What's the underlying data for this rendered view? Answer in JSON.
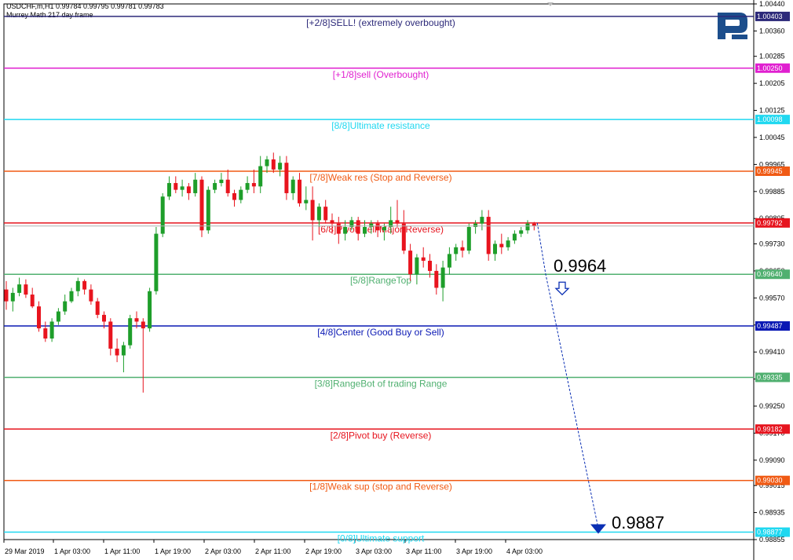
{
  "header": {
    "symbol_line": "USDCHF,m,H1  0.99784 0.99795 0.99781 0.99783",
    "indicator": "Murrey Math 217 day frame"
  },
  "colors": {
    "bull": "#1e9e2a",
    "bear": "#e8141e",
    "arrow": "#0a2fb4",
    "logo": "#1c4e8c"
  },
  "annotations": {
    "target_upper": "0.9964",
    "target_lower": "0.9887"
  },
  "chart_data": {
    "type": "candlestick",
    "title": "USDCHF,m,H1",
    "ylim": [
      0.98855,
      1.0044
    ],
    "y_ticks": [
      "1.00440",
      "1.00360",
      "1.00285",
      "1.00205",
      "1.00125",
      "1.00045",
      "0.99965",
      "0.99885",
      "0.99805",
      "0.99730",
      "0.99650",
      "0.99570",
      "0.99490",
      "0.99410",
      "0.99330",
      "0.99250",
      "0.99170",
      "0.99090",
      "0.99015",
      "0.98935",
      "0.98855"
    ],
    "x_ticks": [
      "29 Mar 2019",
      "1 Apr 03:00",
      "1 Apr 11:00",
      "1 Apr 19:00",
      "2 Apr 03:00",
      "2 Apr 11:00",
      "2 Apr 19:00",
      "3 Apr 03:00",
      "3 Apr 11:00",
      "3 Apr 19:00",
      "4 Apr 03:00"
    ],
    "levels": [
      {
        "label": "[+2/8]SELL! (extremely overbought)",
        "value": 1.00403,
        "value_text": "1.00403",
        "color": "#2d2a7a"
      },
      {
        "label": "[+1/8]sell (Overbought)",
        "value": 1.0025,
        "value_text": "1.00250",
        "color": "#e020d0"
      },
      {
        "label": "[8/8]Ultimate resistance",
        "value": 1.00098,
        "value_text": "1.00098",
        "color": "#20d8f0"
      },
      {
        "label": "[7/8]Weak res (Stop and Reverse)",
        "value": 0.99945,
        "value_text": "0.99945",
        "color": "#f05a14"
      },
      {
        "label": "[6/8]Pivot, sell Major Reverse)",
        "value": 0.99792,
        "value_text": "0.99792",
        "color": "#e6141e"
      },
      {
        "label": "[5/8]RangeTop",
        "value": 0.9964,
        "value_text": "0.99640",
        "color": "#50b070"
      },
      {
        "label": "[4/8]Center (Good Buy or Sell)",
        "value": 0.99487,
        "value_text": "0.99487",
        "color": "#0a18b4"
      },
      {
        "label": "[3/8]RangeBot of trading Range",
        "value": 0.99335,
        "value_text": "0.99335",
        "color": "#50b070"
      },
      {
        "label": "[2/8]Pivot buy (Reverse)",
        "value": 0.99182,
        "value_text": "0.99182",
        "color": "#e6141e"
      },
      {
        "label": "[1/8]Weak sup (stop and Reverse)",
        "value": 0.9903,
        "value_text": "0.99030",
        "color": "#f05a14"
      },
      {
        "label": "[0/8]Ultimate support",
        "value": 0.98877,
        "value_text": "0.98877",
        "color": "#20d8f0"
      }
    ],
    "current_price": 0.99783,
    "current_price_text": "0.99783",
    "forecast": [
      {
        "x": "4 Apr 08:00",
        "y": 0.99792
      },
      {
        "x": "4 Apr 09:00",
        "y": 0.9964
      },
      {
        "x": "4 Apr 14:00",
        "y": 0.98877
      }
    ],
    "candles": [
      [
        0.99595,
        0.9962,
        0.99535,
        0.9956
      ],
      [
        0.9956,
        0.996,
        0.9953,
        0.99585
      ],
      [
        0.99585,
        0.9963,
        0.99575,
        0.9961
      ],
      [
        0.9961,
        0.99625,
        0.9957,
        0.9958
      ],
      [
        0.9958,
        0.996,
        0.9954,
        0.99545
      ],
      [
        0.99545,
        0.9956,
        0.9947,
        0.9948
      ],
      [
        0.9948,
        0.995,
        0.9944,
        0.9945
      ],
      [
        0.9945,
        0.9951,
        0.9944,
        0.995
      ],
      [
        0.995,
        0.9954,
        0.9949,
        0.9953
      ],
      [
        0.9953,
        0.9958,
        0.9952,
        0.9956
      ],
      [
        0.9956,
        0.996,
        0.99555,
        0.9959
      ],
      [
        0.9959,
        0.9963,
        0.99575,
        0.9962
      ],
      [
        0.9962,
        0.99625,
        0.9958,
        0.99595
      ],
      [
        0.99595,
        0.9961,
        0.9955,
        0.9956
      ],
      [
        0.9956,
        0.9957,
        0.9951,
        0.9952
      ],
      [
        0.9952,
        0.9953,
        0.9948,
        0.995
      ],
      [
        0.995,
        0.9951,
        0.994,
        0.9942
      ],
      [
        0.9942,
        0.9945,
        0.9938,
        0.994
      ],
      [
        0.994,
        0.9944,
        0.9935,
        0.9943
      ],
      [
        0.9943,
        0.9952,
        0.9942,
        0.9951
      ],
      [
        0.9951,
        0.9953,
        0.9948,
        0.995
      ],
      [
        0.995,
        0.9951,
        0.9929,
        0.9948
      ],
      [
        0.9948,
        0.996,
        0.9947,
        0.9959
      ],
      [
        0.9959,
        0.9978,
        0.9958,
        0.9976
      ],
      [
        0.9976,
        0.9988,
        0.9975,
        0.9987
      ],
      [
        0.9987,
        0.9993,
        0.9986,
        0.9991
      ],
      [
        0.9991,
        0.9993,
        0.9988,
        0.9989
      ],
      [
        0.9989,
        0.9992,
        0.9987,
        0.999
      ],
      [
        0.999,
        0.9991,
        0.9986,
        0.9988
      ],
      [
        0.9988,
        0.9994,
        0.9987,
        0.9992
      ],
      [
        0.9992,
        0.9993,
        0.9975,
        0.9977
      ],
      [
        0.9977,
        0.999,
        0.9976,
        0.9989
      ],
      [
        0.9989,
        0.9992,
        0.9988,
        0.9991
      ],
      [
        0.9991,
        0.9994,
        0.999,
        0.9992
      ],
      [
        0.9992,
        0.9995,
        0.9987,
        0.9988
      ],
      [
        0.9988,
        0.9989,
        0.9984,
        0.9986
      ],
      [
        0.9986,
        0.999,
        0.9985,
        0.9989
      ],
      [
        0.9989,
        0.9993,
        0.9988,
        0.9991
      ],
      [
        0.9991,
        0.9995,
        0.9988,
        0.999
      ],
      [
        0.999,
        0.9999,
        0.9988,
        0.9996
      ],
      [
        0.9996,
        0.9999,
        0.9994,
        0.9998
      ],
      [
        0.9998,
        1.0,
        0.9994,
        0.9995
      ],
      [
        0.9995,
        0.9999,
        0.9993,
        0.9997
      ],
      [
        0.9997,
        0.9999,
        0.9986,
        0.9988
      ],
      [
        0.9988,
        0.9993,
        0.9986,
        0.9992
      ],
      [
        0.9992,
        0.9994,
        0.9984,
        0.9985
      ],
      [
        0.9985,
        0.999,
        0.9983,
        0.9986
      ],
      [
        0.9986,
        0.999,
        0.9974,
        0.998
      ],
      [
        0.998,
        0.9985,
        0.9978,
        0.9984
      ],
      [
        0.9984,
        0.9986,
        0.9979,
        0.998
      ],
      [
        0.998,
        0.9982,
        0.9976,
        0.9979
      ],
      [
        0.9979,
        0.9981,
        0.9973,
        0.9976
      ],
      [
        0.9976,
        0.998,
        0.9974,
        0.9978
      ],
      [
        0.9978,
        0.9981,
        0.9977,
        0.998
      ],
      [
        0.998,
        0.9981,
        0.9974,
        0.9976
      ],
      [
        0.9976,
        0.998,
        0.9975,
        0.9978
      ],
      [
        0.9978,
        0.998,
        0.9976,
        0.9979
      ],
      [
        0.9979,
        0.998,
        0.9975,
        0.9977
      ],
      [
        0.9977,
        0.9979,
        0.9974,
        0.9978
      ],
      [
        0.9978,
        0.9984,
        0.9976,
        0.998
      ],
      [
        0.998,
        0.9986,
        0.9978,
        0.9979
      ],
      [
        0.9979,
        0.9983,
        0.997,
        0.9971
      ],
      [
        0.9971,
        0.9973,
        0.9962,
        0.9964
      ],
      [
        0.9964,
        0.997,
        0.9961,
        0.9969
      ],
      [
        0.9969,
        0.9972,
        0.9966,
        0.9968
      ],
      [
        0.9968,
        0.997,
        0.9963,
        0.9965
      ],
      [
        0.9965,
        0.9967,
        0.9958,
        0.996
      ],
      [
        0.996,
        0.9968,
        0.9956,
        0.9966
      ],
      [
        0.9966,
        0.9972,
        0.9964,
        0.997
      ],
      [
        0.997,
        0.9973,
        0.9968,
        0.9972
      ],
      [
        0.9972,
        0.9974,
        0.9969,
        0.9971
      ],
      [
        0.9971,
        0.9979,
        0.997,
        0.9978
      ],
      [
        0.9978,
        0.998,
        0.9976,
        0.9979
      ],
      [
        0.9979,
        0.9983,
        0.9977,
        0.9981
      ],
      [
        0.9981,
        0.9983,
        0.9968,
        0.997
      ],
      [
        0.997,
        0.9974,
        0.9968,
        0.9973
      ],
      [
        0.9973,
        0.9976,
        0.997,
        0.9972
      ],
      [
        0.9972,
        0.9975,
        0.9971,
        0.9974
      ],
      [
        0.9974,
        0.9977,
        0.9973,
        0.9976
      ],
      [
        0.9976,
        0.9978,
        0.9975,
        0.9977
      ],
      [
        0.9977,
        0.998,
        0.9976,
        0.9979
      ],
      [
        0.9979,
        0.99795,
        0.9977,
        0.99783
      ]
    ]
  }
}
